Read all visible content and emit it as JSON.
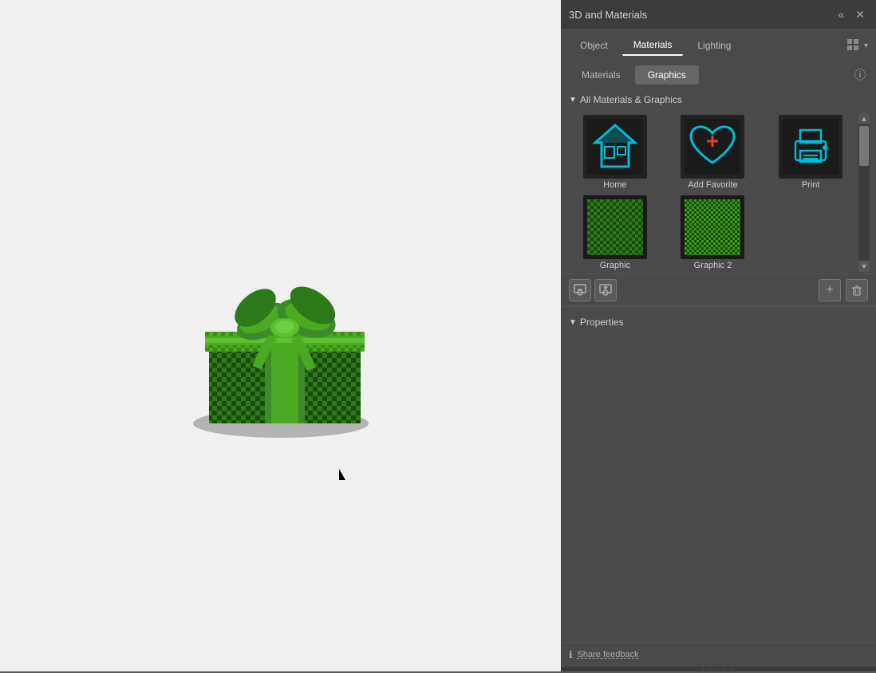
{
  "panel": {
    "title": "3D and Materials",
    "titlebar_collapse": "«",
    "titlebar_close": "✕"
  },
  "tabs": {
    "items": [
      {
        "id": "object",
        "label": "Object",
        "active": false
      },
      {
        "id": "materials",
        "label": "Materials",
        "active": true
      },
      {
        "id": "lighting",
        "label": "Lighting",
        "active": false
      }
    ]
  },
  "sub_tabs": {
    "items": [
      {
        "id": "materials",
        "label": "Materials",
        "active": false
      },
      {
        "id": "graphics",
        "label": "Graphics",
        "active": true
      }
    ]
  },
  "section": {
    "title": "All Materials & Graphics",
    "collapsed": false
  },
  "grid": {
    "items": [
      {
        "id": "home",
        "label": "Home",
        "type": "home"
      },
      {
        "id": "add-favorite",
        "label": "Add Favorite",
        "type": "favorite"
      },
      {
        "id": "print",
        "label": "Print",
        "type": "print"
      },
      {
        "id": "graphic",
        "label": "Graphic",
        "type": "graphic1"
      },
      {
        "id": "graphic2",
        "label": "Graphic 2",
        "type": "graphic2"
      }
    ]
  },
  "toolbar": {
    "import_label": "⬇",
    "export_label": "⬆",
    "add_label": "+",
    "delete_label": "🗑"
  },
  "properties": {
    "title": "Properties"
  },
  "footer": {
    "info_icon": "ℹ",
    "feedback_label": "Share feedback"
  },
  "canvas": {
    "background": "#f0f0f0"
  }
}
